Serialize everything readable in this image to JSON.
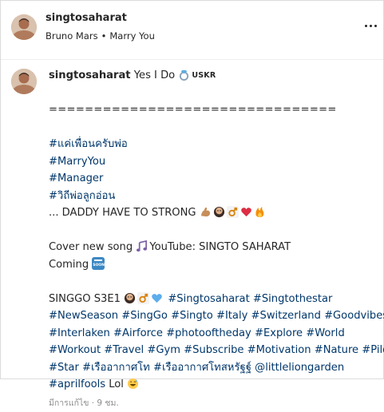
{
  "header": {
    "username": "singtosaharat",
    "music_artist": "Bruno Mars",
    "music_separator": "•",
    "music_song": "Marry You"
  },
  "caption": {
    "username": "singtosaharat",
    "title_text": "Yes I Do",
    "title_suffix": "USKR",
    "divider": "================================",
    "hashtags_block": [
      "#แค่เพื่อนครับพ่อ",
      "#MarryYou",
      "#Manager",
      "#วิถีพ่อลูกอ่อน"
    ],
    "daddy_line": "... DADDY HAVE TO STRONG",
    "cover_line": "Cover new song",
    "cover_link": "YouTube: SINGTO SAHARAT",
    "coming": "Coming",
    "season": "SINGGO S3E1",
    "tag_line_1": [
      "#Singtosaharat",
      "#Singtothestar"
    ],
    "tag_line_2": [
      "#NewSeason",
      "#SingGo",
      "#Singto",
      "#Italy",
      "#Switzerland",
      "#Goodvibes"
    ],
    "tag_line_3": [
      "#Interlaken",
      "#Airforce",
      "#photooftheday",
      "#Explore",
      "#World"
    ],
    "tag_line_4": [
      "#Workout",
      "#Travel",
      "#Gym",
      "#Subscribe",
      "#Motivation",
      "#Nature",
      "#Pilot"
    ],
    "tag_line_5": [
      "#Star",
      "#เรืออากาศโท",
      "#เรืออากาศโทสหรัฐฐ์"
    ],
    "mention": "@littleliongarden",
    "last_tag": "#aprilfools",
    "last_word": "Lol",
    "timestamp": "มีการแก้ไข · 9 ชม."
  },
  "colors": {
    "text": "#262626",
    "link": "#00376b",
    "muted": "#8e8e8e",
    "border": "#dbdbdb"
  },
  "icons": [
    "more-options-icon",
    "ring-icon",
    "flexed-biceps-icon",
    "bearded-face-icon",
    "male-sign-icon",
    "red-heart-icon",
    "fire-icon",
    "musical-notes-icon",
    "soon-arrow-icon",
    "blue-heart-icon",
    "grinning-sweat-icon"
  ]
}
